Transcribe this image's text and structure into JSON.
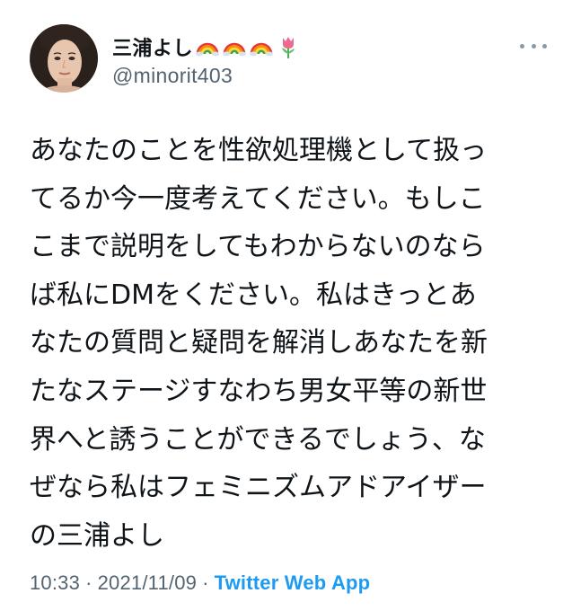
{
  "user": {
    "display_name": "三浦よし",
    "handle": "@minorit403",
    "name_emojis": [
      "rainbow-emoji",
      "rainbow-emoji",
      "rainbow-emoji",
      "tulip-emoji"
    ]
  },
  "tweet": {
    "lines": [
      "あなたのことを性欲処理機として扱っ",
      "てるか今一度考えてください。もしこ",
      "こまで説明をしてもわからないのなら",
      "ば私にDMをください。私はきっとあ",
      "なたの質問と疑問を解消しあなたを新",
      "たなステージすなわち男女平等の新世",
      "界へと誘うことができるでしょう、な",
      "ぜなら私はフェミニズムアドアイザー",
      "の三浦よし"
    ]
  },
  "meta": {
    "time": "10:33",
    "separator": "·",
    "date": "2021/11/09",
    "app": "Twitter Web App"
  },
  "colors": {
    "text": "#0f1419",
    "secondary": "#536471",
    "link": "#1d9bf0"
  }
}
